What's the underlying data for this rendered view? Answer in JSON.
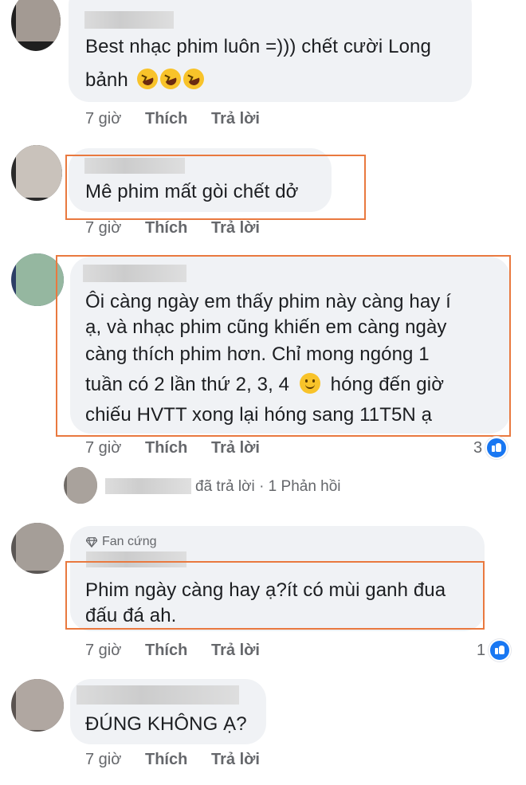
{
  "comments": [
    {
      "text_lines": [
        "Best nhạc phim luôn =))) chết cười Long",
        "bảnh"
      ],
      "emoji": "rofl-emoji x3",
      "time": "7 giờ",
      "like": "Thích",
      "reply": "Trả lời"
    },
    {
      "text_lines": [
        "Mê phim mất gòi chết dở"
      ],
      "time": "7 giờ",
      "like": "Thích",
      "reply": "Trả lời"
    },
    {
      "text_lines": [
        "Ôi càng ngày em thấy phim này càng hay í",
        "ạ, và nhạc phim cũng khiến em càng ngày",
        "càng thích phim hơn. Chỉ mong ngóng 1",
        "tuần có 2 lần thứ 2, 3, 4",
        "hóng đến giờ",
        "chiếu HVTT xong lại hóng sang 11T5N ạ"
      ],
      "time": "7 giờ",
      "like": "Thích",
      "reply": "Trả lời",
      "reaction_count": "3"
    },
    {
      "badge": "Fan cứng",
      "text_lines": [
        "Phim ngày càng hay ạ?ít có mùi ganh đua",
        "đấu đá ah."
      ],
      "time": "7 giờ",
      "like": "Thích",
      "reply": "Trả lời",
      "reaction_count": "1"
    },
    {
      "text_lines": [
        "ĐÚNG KHÔNG Ạ?"
      ],
      "time": "7 giờ",
      "like": "Thích",
      "reply": "Trả lời"
    }
  ],
  "reply_summary": {
    "replied": "đã trả lời",
    "separator": "·",
    "count": "1 Phản hồi"
  },
  "colors": {
    "bubble": "#f0f2f5",
    "highlight": "#e9793f",
    "like_blue": "#1877f2",
    "muted_text": "#65676b"
  }
}
